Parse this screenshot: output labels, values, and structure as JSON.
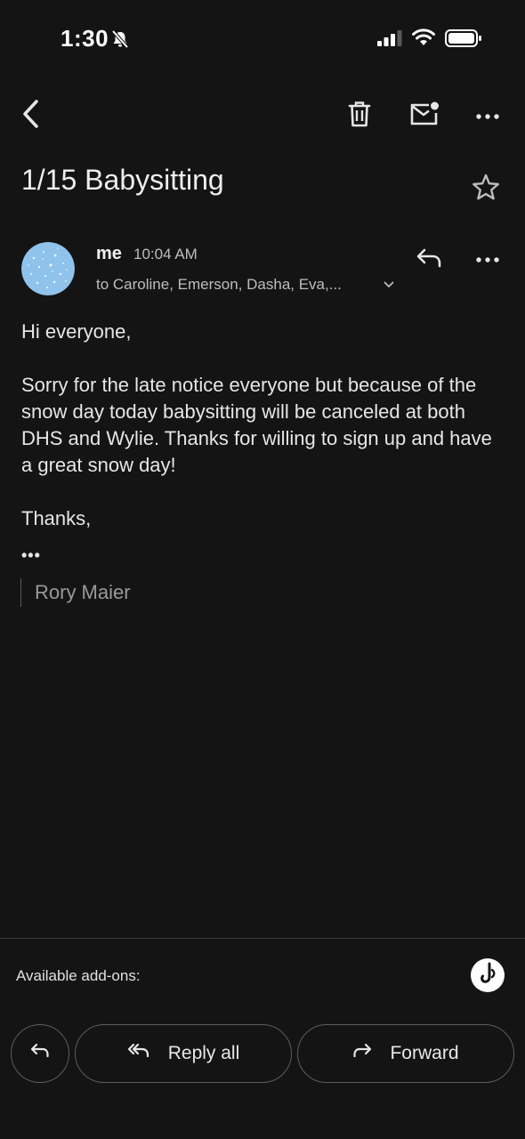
{
  "status_bar": {
    "time": "1:30",
    "icons": [
      "bell-slash-icon",
      "signal-icon",
      "wifi-icon",
      "battery-icon"
    ]
  },
  "toolbar": {
    "icons": [
      "back-icon",
      "trash-icon",
      "mark-unread-icon",
      "more-icon"
    ]
  },
  "email": {
    "subject": "1/15 Babysitting",
    "sender": "me",
    "time": "10:04 AM",
    "recipients": "to Caroline, Emerson, Dasha, Eva,...",
    "greeting": "Hi everyone,",
    "body": "Sorry for the late notice everyone but because of the snow day today babysitting will be canceled at both DHS and Wylie. Thanks for willing to sign up and have a great snow day!",
    "signoff": "Thanks,",
    "trimmed_indicator": "•••",
    "signature": "Rory Maier"
  },
  "bottom": {
    "addons_label": "Available add-ons:",
    "reply_all_label": "Reply all",
    "forward_label": "Forward"
  },
  "colors": {
    "background": "#141414",
    "text": "#e6e6e6",
    "secondary_text": "#bdbdbd",
    "avatar": "#8fc3ec"
  }
}
